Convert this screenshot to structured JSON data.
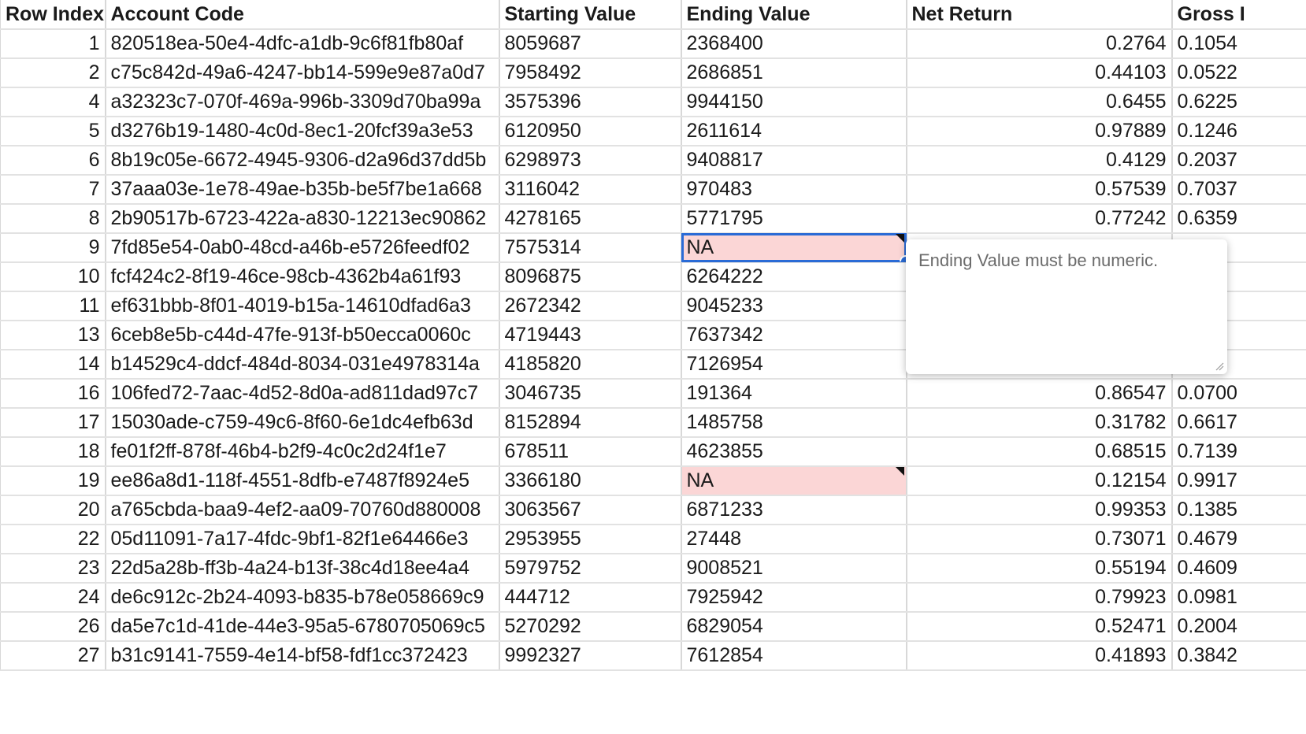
{
  "headers": [
    "Row Index",
    "Account Code",
    "Starting Value",
    "Ending Value",
    "Net Return",
    "Gross I"
  ],
  "rows": [
    [
      "1",
      "820518ea-50e4-4dfc-a1db-9c6f81fb80af",
      "8059687",
      "2368400",
      "0.2764",
      "0.1054"
    ],
    [
      "2",
      "c75c842d-49a6-4247-bb14-599e9e87a0d7",
      "7958492",
      "2686851",
      "0.44103",
      "0.0522"
    ],
    [
      "4",
      "a32323c7-070f-469a-996b-3309d70ba99a",
      "3575396",
      "9944150",
      "0.6455",
      "0.6225"
    ],
    [
      "5",
      "d3276b19-1480-4c0d-8ec1-20fcf39a3e53",
      "6120950",
      "2611614",
      "0.97889",
      "0.1246"
    ],
    [
      "6",
      "8b19c05e-6672-4945-9306-d2a96d37dd5b",
      "6298973",
      "9408817",
      "0.4129",
      "0.2037"
    ],
    [
      "7",
      "37aaa03e-1e78-49ae-b35b-be5f7be1a668",
      "3116042",
      "970483",
      "0.57539",
      "0.7037"
    ],
    [
      "8",
      "2b90517b-6723-422a-a830-12213ec90862",
      "4278165",
      "5771795",
      "0.77242",
      "0.6359"
    ],
    [
      "9",
      "7fd85e54-0ab0-48cd-a46b-e5726feedf02",
      "7575314",
      "NA",
      "",
      ""
    ],
    [
      "10",
      "fcf424c2-8f19-46ce-98cb-4362b4a61f93",
      "8096875",
      "6264222",
      "",
      ""
    ],
    [
      "11",
      "ef631bbb-8f01-4019-b15a-14610dfad6a3",
      "2672342",
      "9045233",
      "",
      ""
    ],
    [
      "13",
      "6ceb8e5b-c44d-47fe-913f-b50ecca0060c",
      "4719443",
      "7637342",
      "",
      ""
    ],
    [
      "14",
      "b14529c4-ddcf-484d-8034-031e4978314a",
      "4185820",
      "7126954",
      "",
      ""
    ],
    [
      "16",
      "106fed72-7aac-4d52-8d0a-ad811dad97c7",
      "3046735",
      "191364",
      "0.86547",
      "0.0700"
    ],
    [
      "17",
      "15030ade-c759-49c6-8f60-6e1dc4efb63d",
      "8152894",
      "1485758",
      "0.31782",
      "0.6617"
    ],
    [
      "18",
      "fe01f2ff-878f-46b4-b2f9-4c0c2d24f1e7",
      "678511",
      "4623855",
      "0.68515",
      "0.7139"
    ],
    [
      "19",
      "ee86a8d1-118f-4551-8dfb-e7487f8924e5",
      "3366180",
      "NA",
      "0.12154",
      "0.9917"
    ],
    [
      "20",
      "a765cbda-baa9-4ef2-aa09-70760d880008",
      "3063567",
      "6871233",
      "0.99353",
      "0.1385"
    ],
    [
      "22",
      "05d11091-7a17-4fdc-9bf1-82f1e64466e3",
      "2953955",
      "27448",
      "0.73071",
      "0.4679"
    ],
    [
      "23",
      "22d5a28b-ff3b-4a24-b13f-38c4d18ee4a4",
      "5979752",
      "9008521",
      "0.55194",
      "0.4609"
    ],
    [
      "24",
      "de6c912c-2b24-4093-b835-b78e058669c9",
      "444712",
      "7925942",
      "0.79923",
      "0.0981"
    ],
    [
      "26",
      "da5e7c1d-41de-44e3-95a5-6780705069c5",
      "5270292",
      "6829054",
      "0.52471",
      "0.2004"
    ],
    [
      "27",
      "b31c9141-7559-4e14-bf58-fdf1cc372423",
      "9992327",
      "7612854",
      "0.41893",
      "0.3842"
    ]
  ],
  "error_rows": [
    7,
    15
  ],
  "selected_row": 7,
  "tooltip": {
    "text": "Ending Value must be numeric."
  },
  "colors": {
    "error_fill": "#fbd6d6",
    "selection": "#2a6bd6",
    "header_text": "#1a1a1a"
  }
}
